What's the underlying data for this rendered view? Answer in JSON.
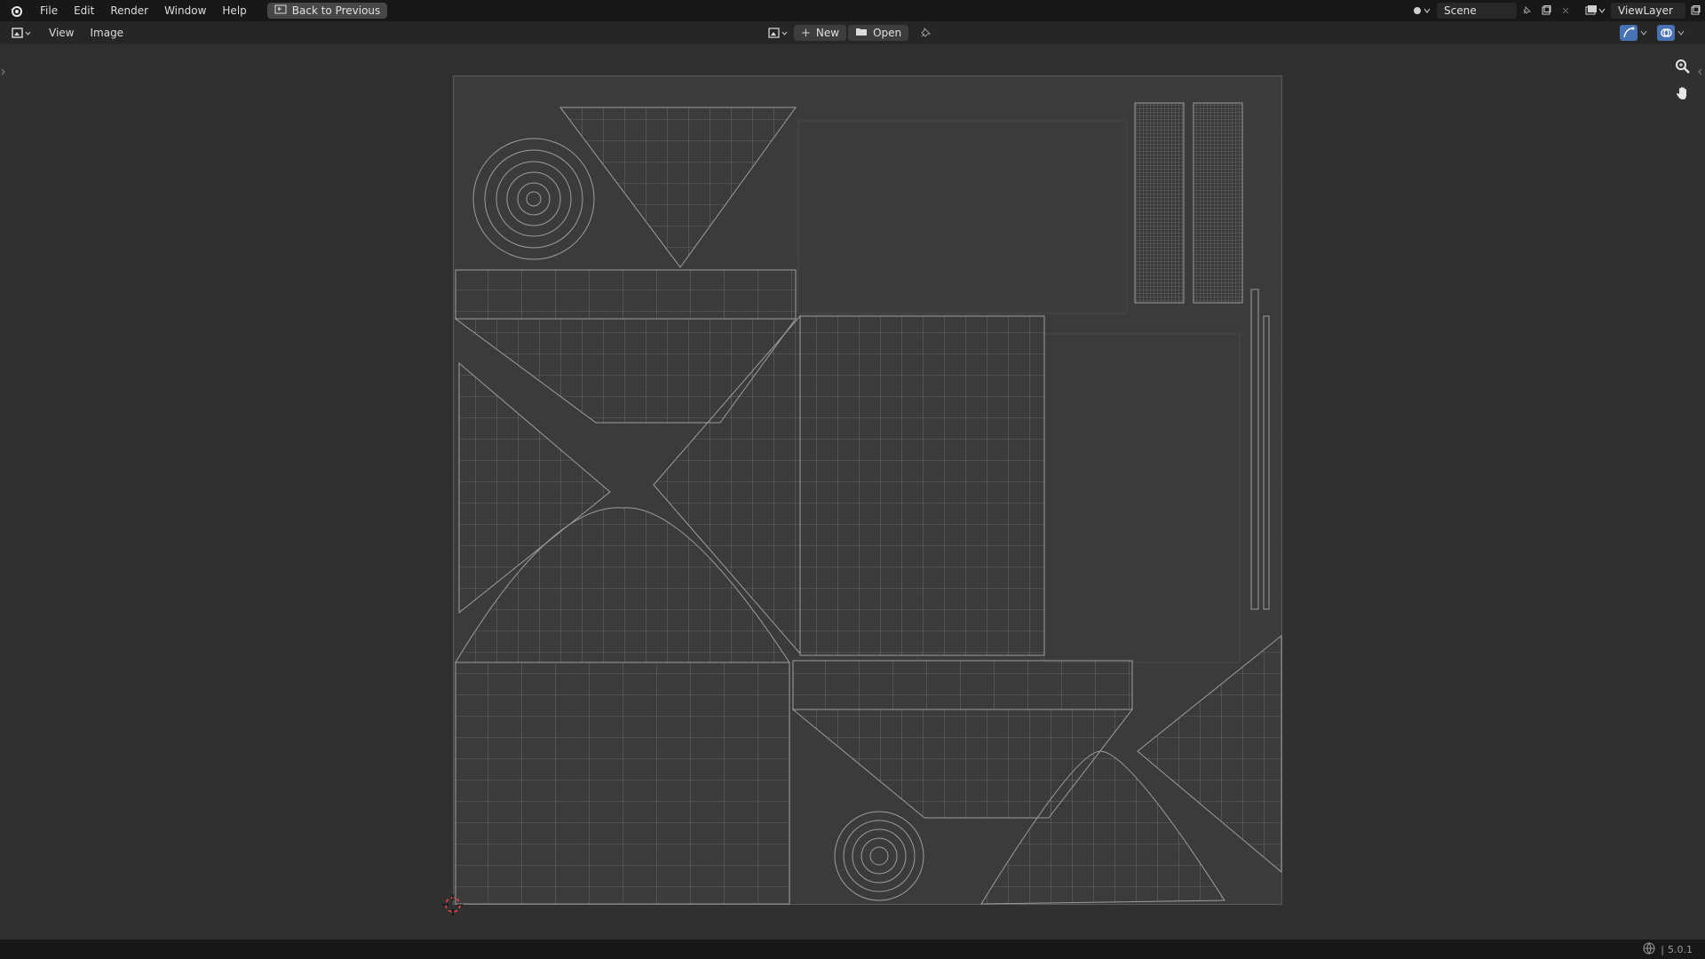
{
  "topbar": {
    "menus": [
      "File",
      "Edit",
      "Render",
      "Window",
      "Help"
    ],
    "back_button": "Back to Previous",
    "scene_name": "Scene",
    "view_layer": "ViewLayer"
  },
  "editor_header": {
    "menus": [
      "View",
      "Image"
    ],
    "new_label": "New",
    "open_label": "Open"
  },
  "status": {
    "version": "5.0.1"
  },
  "icons": {
    "logo": "blender-logo-icon",
    "editor_type": "image-editor-icon",
    "browse_image": "image-browse-icon",
    "new": "plus-icon",
    "open": "folder-icon",
    "pin": "pin-icon",
    "zoom": "zoom-icon",
    "pan": "hand-icon",
    "cursor": "2d-cursor-icon"
  },
  "colors": {
    "topbar_bg": "#181818",
    "header_bg": "#262626",
    "viewport_bg": "#303030",
    "wireframe": "#9a9a9a",
    "active_blue": "#4772b3"
  }
}
